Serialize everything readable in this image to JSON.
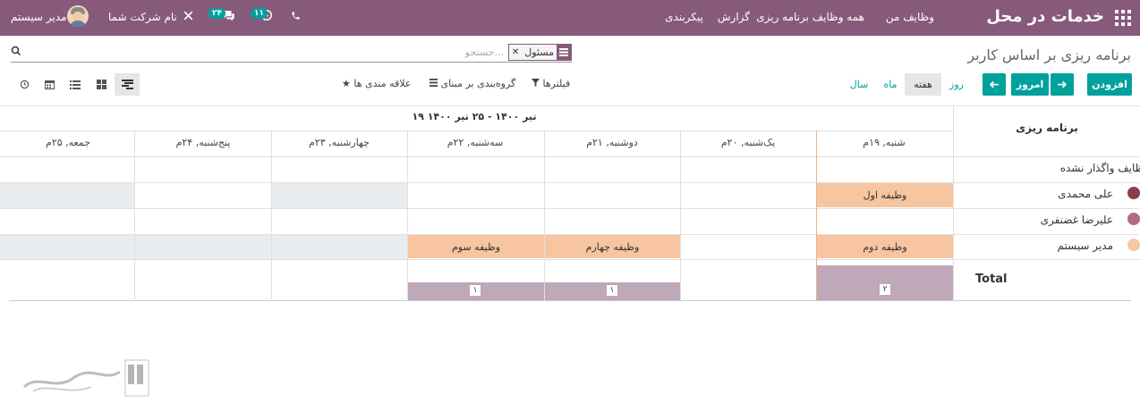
{
  "navbar": {
    "brand": "خدمات در محل",
    "menu": [
      "وظایف من",
      "همه وظایف",
      "برنامه ریزی",
      "گزارش",
      "پیکربندی"
    ],
    "messages_count": "۲۴",
    "activities_count": "۱۱",
    "company": "نام شرکت شما",
    "user": "مدیر سیستم",
    "colors": {
      "primary": "#875a7b",
      "accent": "#00a09d"
    }
  },
  "control": {
    "title": "برنامه ریزی بر اساس کاربر",
    "facet_value": "مسئول",
    "search_placeholder": "جستجو...",
    "add_label": "افزودن",
    "today_label": "امروز",
    "scales": [
      "روز",
      "هفته",
      "ماه",
      "سال"
    ],
    "active_scale": "هفته",
    "filters_label": "فیلترها",
    "groupby_label": "گروه‌بندی بر مبنای",
    "favorites_label": "علاقه مندی ها"
  },
  "gantt": {
    "planning_header": "برنامه ریزی",
    "date_range": "۱۹ تیر ۱۴۰۰ - ۲۵ تیر ۱۴۰۰",
    "days": [
      "شنبه, ۱۹م",
      "یک‌شنبه, ۲۰م",
      "دوشنبه, ۲۱م",
      "سه‌شنبه, ۲۲م",
      "چهارشنبه, ۲۳م",
      "پنج‌شنبه, ۲۴م",
      "جمعه, ۲۵م"
    ],
    "rows": [
      "وظایف واگذار نشده",
      "علی محمدی",
      "علیرضا غضنفری",
      "مدیر سیستم"
    ],
    "tasks": {
      "task1": "وظیفه اول",
      "task2": "وظیفه دوم",
      "task4": "وظیفه چهارم",
      "task3": "وظیفه سوم"
    },
    "total_label": "Total",
    "totals": {
      "sat": "۲",
      "mon": "۱",
      "tue": "۱"
    }
  }
}
